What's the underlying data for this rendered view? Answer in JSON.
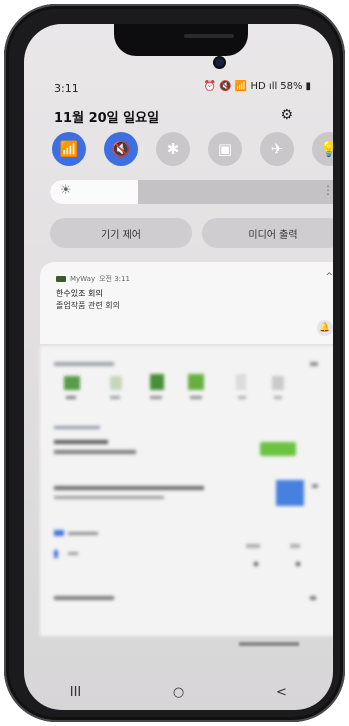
{
  "status": {
    "time": "3:11",
    "indicators": "⏰ 🔇 📶 HD ıll",
    "battery": "58%"
  },
  "panel": {
    "date": "11월 20일 일요일",
    "brightness_level": 0.3,
    "controls": {
      "device": "기기 제어",
      "media": "미디어 출력"
    }
  },
  "quick_settings": [
    {
      "name": "wifi",
      "glyph": "📶",
      "on": true
    },
    {
      "name": "sound",
      "glyph": "🔇",
      "on": true
    },
    {
      "name": "bluetooth",
      "glyph": "✱",
      "on": false
    },
    {
      "name": "rotation",
      "glyph": "▣",
      "on": false
    },
    {
      "name": "airplane",
      "glyph": "✈",
      "on": false
    },
    {
      "name": "flashlight",
      "glyph": "💡",
      "on": false
    }
  ],
  "notification": {
    "app": "MyWay",
    "time": "오전 3:11",
    "title": "한수있조 회의",
    "body": "졸업작품 관련 회의"
  },
  "navigation": {
    "recents": "III",
    "home": "○",
    "back": "<"
  },
  "colors": {
    "accent": "#3e6fe0",
    "green": "#67c23a"
  }
}
